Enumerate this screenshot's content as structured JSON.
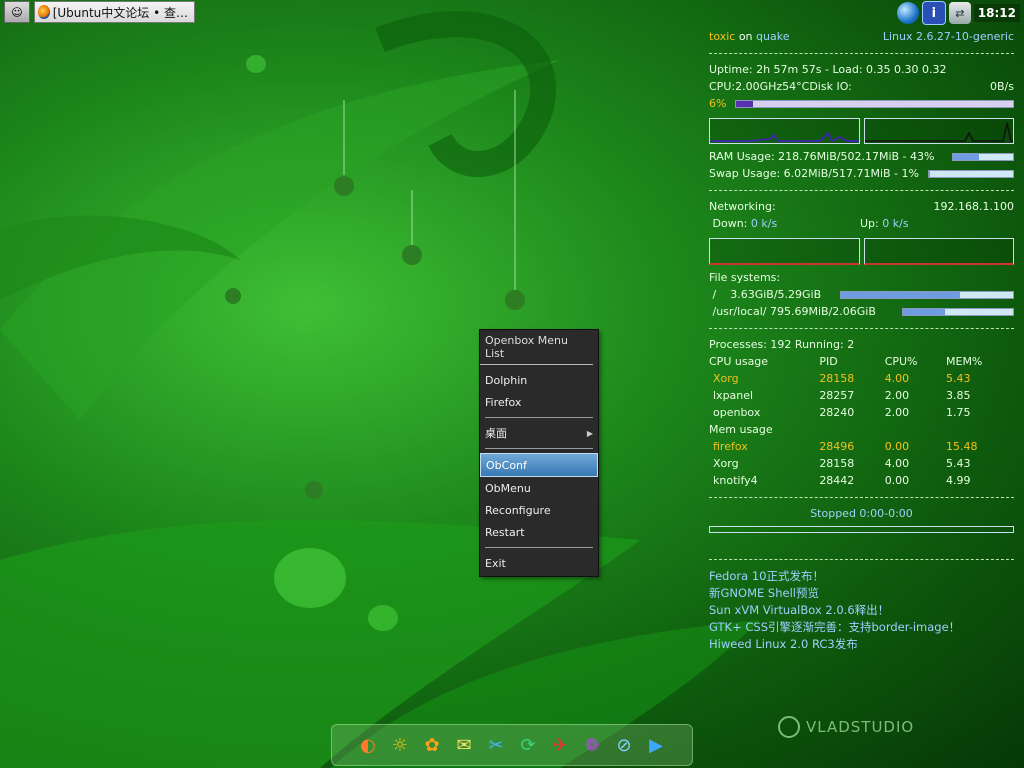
{
  "taskbar": {
    "launcher_label": "☺",
    "task_title": "[Ubuntu中文论坛 • 查…"
  },
  "tray": {
    "globe_icon": "globe-icon",
    "info_label": "i",
    "network_label": "⇄",
    "clock": "18:12"
  },
  "conky": {
    "user": "toxic",
    "on": "on",
    "host": "quake",
    "kernel": "Linux 2.6.27-10-generic",
    "uptime_line": "Uptime: 2h 57m 57s - Load: 0.35 0.30 0.32",
    "cpu_label": "CPU:",
    "cpu_freq": "2.00GHz",
    "cpu_temp": "54°C",
    "disk_io_label": "Disk IO:",
    "disk_io_value": "0B/s",
    "cpu_percent": "6%",
    "cpu_fraction": 0.06,
    "ram_line": "RAM Usage: 218.76MiB/502.17MiB - 43%",
    "ram_fraction": 0.43,
    "swap_line": "Swap Usage: 6.02MiB/517.71MiB - 1%",
    "swap_fraction": 0.01,
    "networking_label": "Networking:",
    "ip": "192.168.1.100",
    "down_label": "Down:",
    "down_value": "0 k/s",
    "up_label": "Up:",
    "up_value": "0 k/s",
    "fs_label": "File systems:",
    "fs": [
      {
        "mount": "/",
        "usage": "3.63GiB/5.29GiB",
        "fraction": 0.69
      },
      {
        "mount": "/usr/local/",
        "usage": "795.69MiB/2.06GiB",
        "fraction": 0.38
      }
    ],
    "processes_line": "Processes: 192  Running: 2",
    "cpu_usage_header": [
      "CPU usage",
      "PID",
      "CPU%",
      "MEM%"
    ],
    "cpu_procs": [
      {
        "name": "Xorg",
        "pid": "28158",
        "cpu": "4.00",
        "mem": "5.43",
        "highlight": true
      },
      {
        "name": "lxpanel",
        "pid": "28257",
        "cpu": "2.00",
        "mem": "3.85",
        "highlight": false
      },
      {
        "name": "openbox",
        "pid": "28240",
        "cpu": "2.00",
        "mem": "1.75",
        "highlight": false
      }
    ],
    "mem_usage_header": "Mem usage",
    "mem_procs": [
      {
        "name": "firefox",
        "pid": "28496",
        "cpu": "0.00",
        "mem": "15.48",
        "highlight": true
      },
      {
        "name": "Xorg",
        "pid": "28158",
        "cpu": "4.00",
        "mem": "5.43",
        "highlight": false
      },
      {
        "name": "knotify4",
        "pid": "28442",
        "cpu": "0.00",
        "mem": "4.99",
        "highlight": false
      }
    ],
    "player_status": "Stopped 0:00-0:00",
    "news": [
      "Fedora 10正式发布！",
      "新GNOME Shell预览",
      "Sun xVM VirtualBox 2.0.6释出！",
      "GTK+ CSS引擎逐渐完善：支持border-image！",
      "Hiweed Linux 2.0 RC3发布"
    ]
  },
  "menu": {
    "title": "Openbox Menu List",
    "items": [
      "Dolphin",
      "Firefox",
      "桌面",
      "ObConf",
      "ObMenu",
      "Reconfigure",
      "Restart",
      "Exit"
    ]
  },
  "dock": {
    "icons": [
      "◐",
      "☼",
      "✿",
      "✉",
      "✂",
      "⟳",
      "✈",
      "❁",
      "⊘",
      "▶"
    ]
  },
  "brand": {
    "text": "VLADSTUDIO"
  }
}
